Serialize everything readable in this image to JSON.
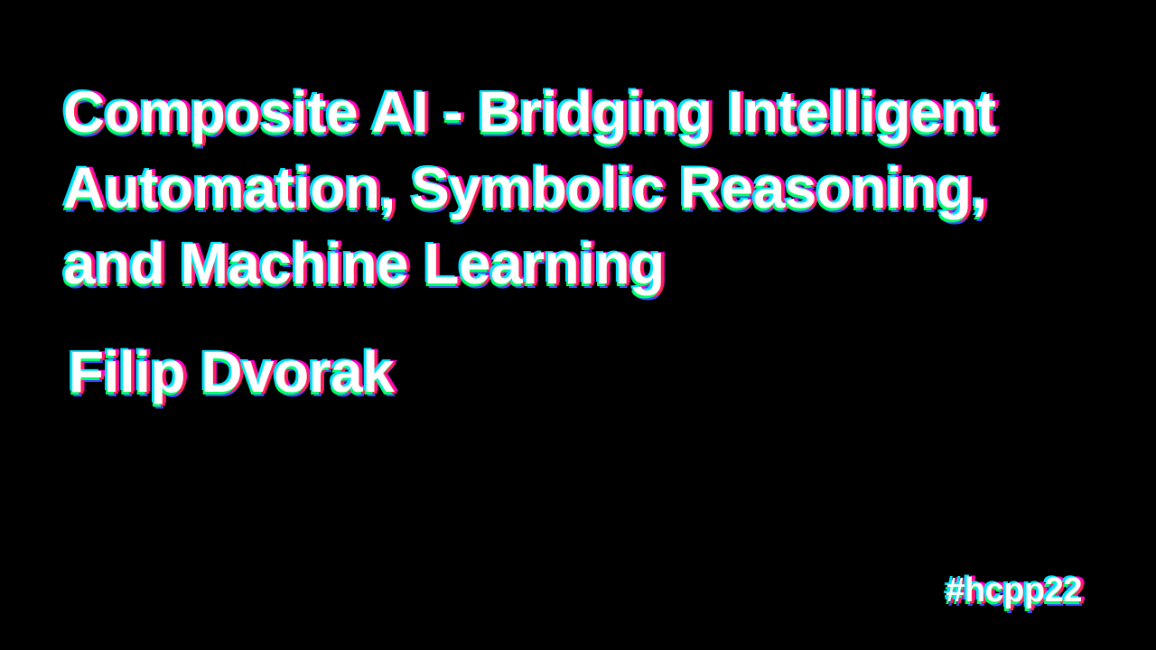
{
  "slide": {
    "title_lines": [
      "Composite AI - Bridging Intelligent",
      "Automation, Symbolic Reasoning,",
      "and Machine Learning"
    ],
    "speaker": "Filip Dvorak",
    "hashtag": "#hcpp22"
  },
  "colors": {
    "background": "#000000",
    "text": "#ffffff",
    "glitch_cyan": "#00e5ff",
    "glitch_green": "#00ff66",
    "glitch_red": "#ff1f5a",
    "glitch_magenta": "#ff00cc",
    "glitch_blue": "#3b4bff"
  }
}
